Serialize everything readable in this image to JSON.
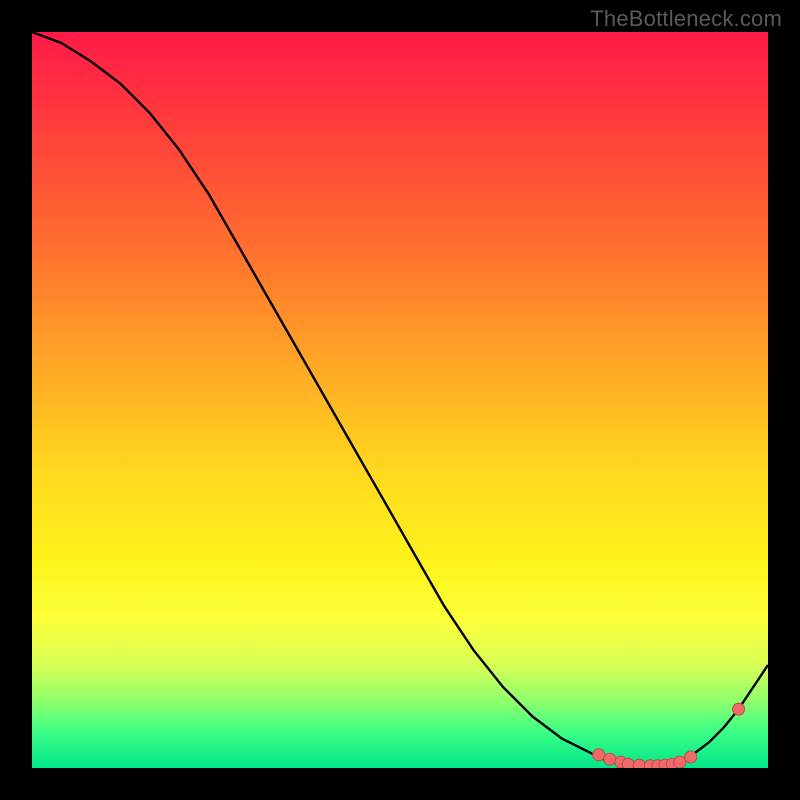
{
  "watermark": "TheBottleneck.com",
  "colors": {
    "curve_stroke": "#000000",
    "marker_fill": "#f06a6a",
    "marker_stroke": "#c24a4a"
  },
  "chart_data": {
    "type": "line",
    "title": "",
    "xlabel": "",
    "ylabel": "",
    "xlim": [
      0,
      100
    ],
    "ylim": [
      0,
      100
    ],
    "grid": false,
    "legend": false,
    "x": [
      0,
      4,
      8,
      12,
      16,
      20,
      24,
      28,
      32,
      36,
      40,
      44,
      48,
      52,
      56,
      60,
      64,
      68,
      72,
      76,
      78,
      80,
      82,
      84,
      86,
      88,
      90,
      92,
      94,
      96,
      98,
      100
    ],
    "y": [
      100,
      98.5,
      96,
      93,
      89,
      84,
      78,
      71,
      64,
      57,
      50,
      43,
      36,
      29,
      22,
      16,
      11,
      7,
      4,
      2,
      1,
      0.5,
      0.3,
      0.3,
      0.5,
      1,
      2,
      3.5,
      5.5,
      8,
      11,
      14
    ],
    "markers": [
      {
        "x": 77,
        "y": 1.8
      },
      {
        "x": 78.5,
        "y": 1.2
      },
      {
        "x": 80,
        "y": 0.8
      },
      {
        "x": 81,
        "y": 0.5
      },
      {
        "x": 82.5,
        "y": 0.4
      },
      {
        "x": 84,
        "y": 0.3
      },
      {
        "x": 85,
        "y": 0.3
      },
      {
        "x": 86,
        "y": 0.4
      },
      {
        "x": 87,
        "y": 0.5
      },
      {
        "x": 88,
        "y": 0.8
      },
      {
        "x": 89.5,
        "y": 1.5
      },
      {
        "x": 96,
        "y": 8
      }
    ]
  }
}
